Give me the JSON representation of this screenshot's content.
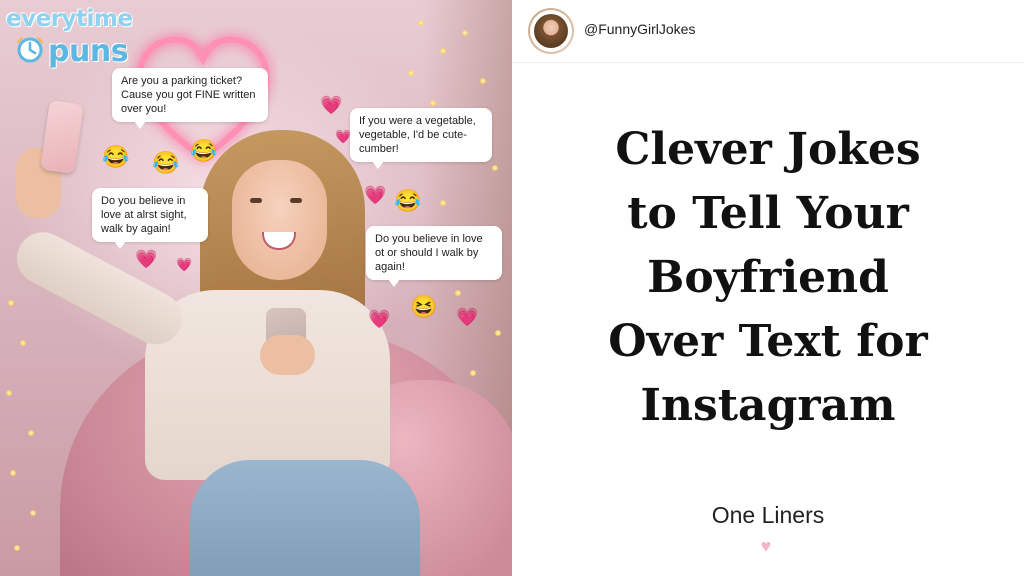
{
  "logo": {
    "line1": "everytime",
    "line2": "puns"
  },
  "bubbles": [
    "Are you a parking ticket? Cause you got FINE written over you!",
    "If you were a vegetable, vegetable, I'd be cute-cumber!",
    "Do you believe in love at alrst sight, walk by again!",
    "Do you believe in love ot or should I walk by again!"
  ],
  "emoji": {
    "laugh": "😂",
    "grin": "😆",
    "heart": "💗"
  },
  "profile": {
    "handle": "@FunnyGirlJokes"
  },
  "post": {
    "title_lines": [
      "Clever Jokes",
      "to Tell Your",
      "Boyfriend",
      "Over Text for",
      "Instagram"
    ],
    "subtitle": "One Liners",
    "heart": "♥"
  },
  "colors": {
    "accent_pink": "#e64a8c",
    "logo_blue": "#5cb7e2",
    "title": "#111111"
  }
}
